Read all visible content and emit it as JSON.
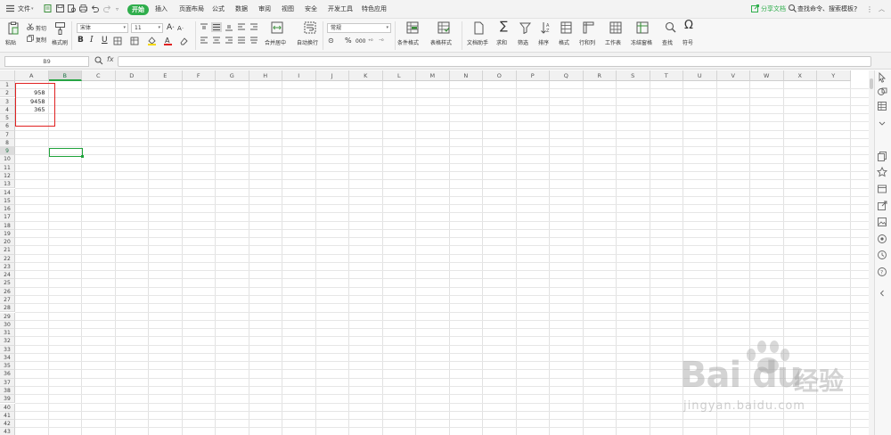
{
  "menu": {
    "file": "文件",
    "tabs": [
      "开始",
      "插入",
      "页面布局",
      "公式",
      "数据",
      "审阅",
      "视图",
      "安全",
      "开发工具",
      "特色应用"
    ],
    "active_tab": "开始",
    "share": "分享文档",
    "search": "查找命令、搜索模板",
    "help": "?"
  },
  "ribbon": {
    "paste": "粘贴",
    "cut": "剪切",
    "copy": "复制",
    "format_painter": "格式刷",
    "font_name": "宋体",
    "font_size": "11",
    "bold": "B",
    "italic": "I",
    "underline": "U",
    "merge_center": "合并居中",
    "wrap_text": "自动换行",
    "number_format": "常规",
    "conditional_format": "条件格式",
    "table_style": "表格样式",
    "doc_helper": "文档助手",
    "sum": "求和",
    "filter": "筛选",
    "sort": "排序",
    "format": "格式",
    "row_col": "行和列",
    "worksheet": "工作表",
    "freeze": "冻结窗格",
    "find": "查找",
    "symbol": "符号"
  },
  "formula_bar": {
    "name_box": "B9",
    "fx": "fx",
    "formula": ""
  },
  "sheet": {
    "columns": [
      "A",
      "B",
      "C",
      "D",
      "E",
      "F",
      "G",
      "H",
      "I",
      "J",
      "K",
      "L",
      "M",
      "N",
      "O",
      "P",
      "Q",
      "R",
      "S",
      "T",
      "U",
      "V",
      "W",
      "X",
      "Y"
    ],
    "rows": [
      "1",
      "2",
      "3",
      "4",
      "5",
      "6",
      "7",
      "8",
      "9",
      "10",
      "11",
      "12",
      "13",
      "14",
      "15",
      "16",
      "17",
      "18",
      "19",
      "20",
      "21",
      "22",
      "23",
      "24",
      "25",
      "26",
      "27",
      "28",
      "29",
      "30",
      "31",
      "32",
      "33",
      "34",
      "35",
      "36",
      "37",
      "38",
      "39",
      "40",
      "41",
      "42",
      "43"
    ],
    "selected_cell": "B9",
    "cells": [
      {
        "ref": "A2",
        "value": "958"
      },
      {
        "ref": "A3",
        "value": "9458"
      },
      {
        "ref": "A4",
        "value": "365"
      }
    ]
  },
  "watermark": {
    "logo": "Bai du",
    "cn": "经验",
    "url": "jingyan.baidu.com"
  },
  "colors": {
    "accent_green": "#2fae4c",
    "annotation_red": "#e02020",
    "selection_green": "#1fa33b"
  }
}
